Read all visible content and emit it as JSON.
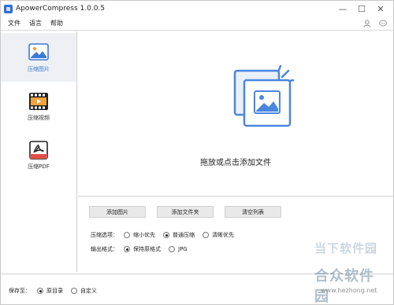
{
  "window": {
    "title": "ApowerCompress 1.0.0.5"
  },
  "window_controls": {
    "minimize": "—",
    "maximize": "☐",
    "close": "✕"
  },
  "menu": {
    "items": [
      "文件",
      "语言",
      "帮助"
    ]
  },
  "sidebar": {
    "items": [
      {
        "label": "压缩图片",
        "icon": "image-icon",
        "active": true
      },
      {
        "label": "压缩视频",
        "icon": "video-icon",
        "active": false
      },
      {
        "label": "压缩PDF",
        "icon": "pdf-icon",
        "active": false
      }
    ]
  },
  "main": {
    "drop_text": "拖放或点击添加文件"
  },
  "buttons": {
    "add_image": "添加图片",
    "add_folder": "添加文件夹",
    "clear_list": "清空列表"
  },
  "options": {
    "compress_label": "压缩选项：",
    "compress": [
      {
        "label": "缩小优先",
        "selected": false
      },
      {
        "label": "普通压缩",
        "selected": true
      },
      {
        "label": "清晰优先",
        "selected": false
      }
    ],
    "format_label": "输出格式：",
    "format": [
      {
        "label": "保持原格式",
        "selected": true
      },
      {
        "label": "JPG",
        "selected": false
      }
    ]
  },
  "footer": {
    "save_label": "保存至：",
    "save": [
      {
        "label": "原目录",
        "selected": true
      },
      {
        "label": "自定义",
        "selected": false
      }
    ]
  },
  "watermark": {
    "line1": "当下软件园",
    "line2": "合众软件园",
    "url": "www.hezhong.net"
  },
  "colors": {
    "accent": "#3b7bd6",
    "sidebar_active_bg": "#eef0f3"
  }
}
